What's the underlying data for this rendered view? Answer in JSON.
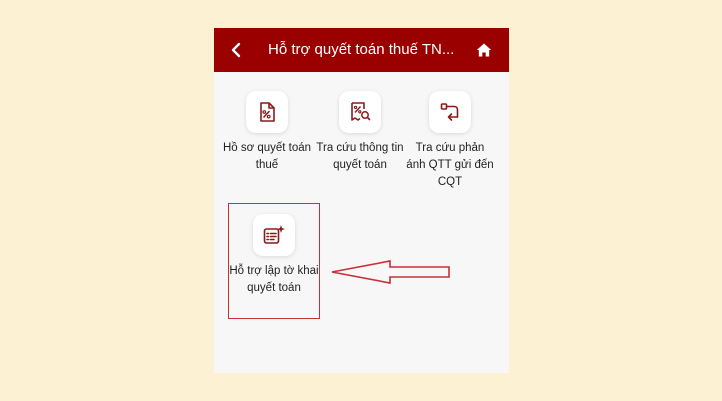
{
  "header": {
    "title": "Hỗ trợ quyết toán thuế TN...",
    "back_icon": "chevron-left-icon",
    "home_icon": "home-icon",
    "background": "#9b0000"
  },
  "tiles": [
    {
      "label": "Hồ sơ quyết toán thuế",
      "icon": "tax-document-icon"
    },
    {
      "label": "Tra cứu thông tin quyết toán",
      "icon": "percent-search-icon"
    },
    {
      "label": "Tra cứu phản ánh QTT gửi đến CQT",
      "icon": "feedback-icon"
    },
    {
      "label": "Hỗ trợ lập tờ khai quyết toán",
      "icon": "form-sparkle-icon"
    }
  ],
  "annotation": {
    "highlight_color": "#c9303a",
    "arrow_icon": "left-arrow-callout-icon"
  },
  "colors": {
    "page_background": "#fdf1d3",
    "accent": "#9b0000",
    "icon_color": "#8a1a1a"
  }
}
